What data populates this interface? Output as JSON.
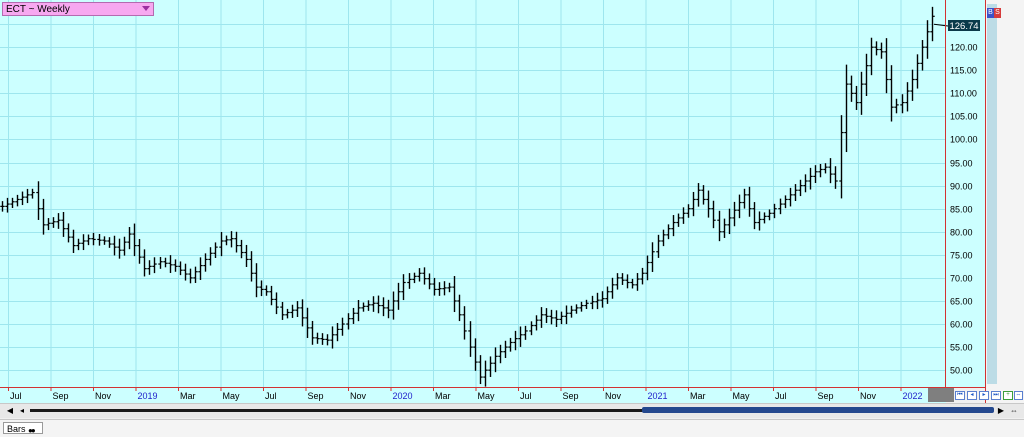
{
  "symbol": {
    "label": "ECT ~ Weekly"
  },
  "last_price": "126.74",
  "colors": {
    "background": "#ccffff",
    "grid": "#9ee6ee",
    "bar": "#000000",
    "axis_line": "#d23232",
    "year_label": "#2222cc",
    "price_box": "#0a3a4a"
  },
  "chart_data": {
    "type": "ohlc",
    "title": "ECT ~ Weekly",
    "x_tick_labels": [
      "Jul",
      "Sep",
      "Nov",
      "2019",
      "Mar",
      "May",
      "Jul",
      "Sep",
      "Nov",
      "2020",
      "Mar",
      "May",
      "Jul",
      "Sep",
      "Nov",
      "2021",
      "Mar",
      "May",
      "Jul",
      "Sep",
      "Nov",
      "2022"
    ],
    "x_tick_is_year": [
      false,
      false,
      false,
      true,
      false,
      false,
      false,
      false,
      false,
      true,
      false,
      false,
      false,
      false,
      false,
      true,
      false,
      false,
      false,
      false,
      false,
      true
    ],
    "y_ticks": [
      50,
      55,
      60,
      65,
      70,
      75,
      80,
      85,
      90,
      95,
      100,
      105,
      110,
      115,
      120,
      125
    ],
    "ylim": [
      47,
      128.5
    ],
    "grid": true,
    "anchors": [
      [
        0,
        85.5
      ],
      [
        3,
        87
      ],
      [
        6,
        88.5
      ],
      [
        8,
        81.5
      ],
      [
        11,
        82.5
      ],
      [
        14,
        77
      ],
      [
        17,
        78.5
      ],
      [
        20,
        78
      ],
      [
        23,
        76
      ],
      [
        25,
        79.5
      ],
      [
        28,
        72
      ],
      [
        31,
        73.5
      ],
      [
        34,
        72.5
      ],
      [
        37,
        70
      ],
      [
        40,
        74
      ],
      [
        43,
        78
      ],
      [
        45,
        78.5
      ],
      [
        48,
        74
      ],
      [
        50,
        68
      ],
      [
        52,
        67
      ],
      [
        55,
        62
      ],
      [
        58,
        63.5
      ],
      [
        61,
        57
      ],
      [
        64,
        56.5
      ],
      [
        67,
        60
      ],
      [
        70,
        63.5
      ],
      [
        73,
        64.5
      ],
      [
        76,
        63
      ],
      [
        79,
        69
      ],
      [
        82,
        71
      ],
      [
        85,
        67.5
      ],
      [
        88,
        68
      ],
      [
        90,
        62
      ],
      [
        92,
        55
      ],
      [
        94,
        48.5
      ],
      [
        97,
        53
      ],
      [
        100,
        56
      ],
      [
        103,
        58.5
      ],
      [
        106,
        62
      ],
      [
        109,
        61
      ],
      [
        112,
        63
      ],
      [
        115,
        64.5
      ],
      [
        118,
        65.5
      ],
      [
        121,
        70
      ],
      [
        124,
        68.5
      ],
      [
        126,
        71
      ],
      [
        129,
        78
      ],
      [
        132,
        82
      ],
      [
        135,
        85
      ],
      [
        137,
        89
      ],
      [
        139,
        85
      ],
      [
        141,
        80
      ],
      [
        143,
        83
      ],
      [
        146,
        88
      ],
      [
        148,
        82
      ],
      [
        151,
        84
      ],
      [
        154,
        87
      ],
      [
        157,
        90
      ],
      [
        160,
        93
      ],
      [
        162,
        94
      ],
      [
        164,
        91
      ],
      [
        166,
        112
      ],
      [
        168,
        108
      ],
      [
        171,
        120
      ],
      [
        173,
        119
      ],
      [
        175,
        107
      ],
      [
        177,
        108
      ],
      [
        179,
        113
      ],
      [
        181,
        120
      ],
      [
        183,
        126.7
      ]
    ]
  },
  "scrollbar": {
    "left_arrow": "◀",
    "right_arrow": "▶"
  },
  "statusbar": {
    "tab_label": "Bars"
  }
}
